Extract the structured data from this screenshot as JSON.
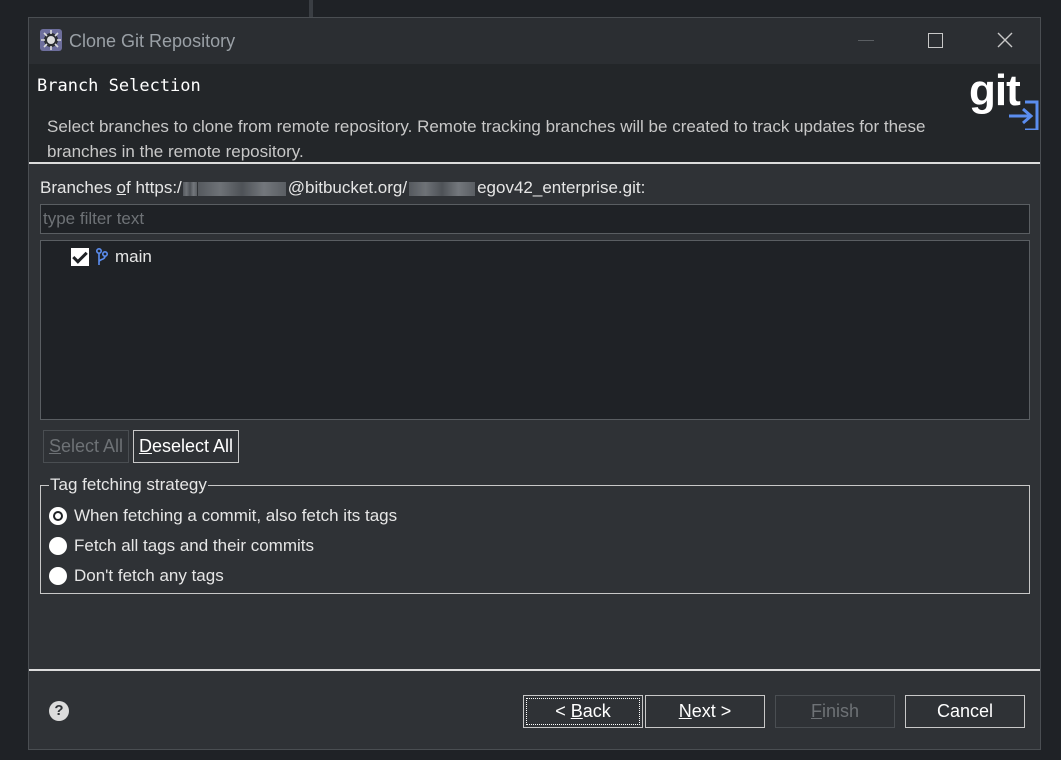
{
  "window": {
    "title": "Clone Git Repository"
  },
  "header": {
    "page_title": "Branch Selection",
    "description": "Select branches to clone from remote repository. Remote tracking branches will be created to track updates for these branches in the remote repository.",
    "logo_text": "git"
  },
  "branches": {
    "label_prefix": "Branches ",
    "label_mnemonic": "o",
    "label_after_mnemonic": "f https:/",
    "label_host": "@bitbucket.org/",
    "label_repo": "egov42_enterprise.git:",
    "filter_placeholder": "type filter text",
    "items": [
      {
        "label": "main",
        "checked": true
      }
    ]
  },
  "selection_buttons": {
    "select_all_mnemonic": "S",
    "select_all_rest": "elect All",
    "deselect_all_mnemonic": "D",
    "deselect_all_rest": "eselect All"
  },
  "tag_strategy": {
    "title": "Tag fetching strategy",
    "options": [
      {
        "label": "When fetching a commit, also fetch its tags",
        "selected": true
      },
      {
        "label": "Fetch all tags and their commits",
        "selected": false
      },
      {
        "label": "Don't fetch any tags",
        "selected": false
      }
    ]
  },
  "footer": {
    "back_prefix": "< ",
    "back_mnemonic": "B",
    "back_rest": "ack",
    "next_mnemonic": "N",
    "next_rest": "ext >",
    "finish_mnemonic": "F",
    "finish_rest": "inish",
    "cancel_label": "Cancel",
    "help_symbol": "?"
  },
  "colors": {
    "accent": "#5b8def",
    "background": "#2f3236",
    "field_background": "#1f2226"
  }
}
